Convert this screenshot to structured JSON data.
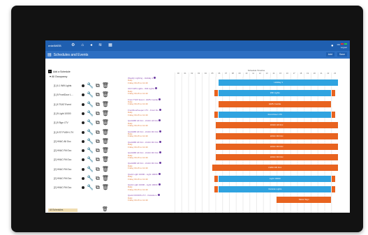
{
  "topbar": {
    "brand": "enteliWEB",
    "nav_icons": [
      "gear-icon",
      "home-icon",
      "back-icon",
      "wifi-icon",
      "calendar-icon"
    ],
    "user_icon": "user-icon",
    "status_text": "OK",
    "logout": "Logout"
  },
  "subheader": {
    "title": "Schedules and Events",
    "actions": [
      "Add",
      "Save"
    ]
  },
  "tree": {
    "root": "Add a Schedule",
    "group": "All Occupancy",
    "rows": [
      {
        "label": "[1] 6.1 Wifi Lights"
      },
      {
        "label": "[1] 8 FrontDoor L..."
      },
      {
        "label": "[1] 8 TSAT Event"
      },
      {
        "label": "[1] 8 Light 10000"
      },
      {
        "label": "[1] 8 Sign LTV"
      },
      {
        "label": "[1] 8 ST PUSH LTV"
      },
      {
        "label": "[2] HVAC All Occ"
      },
      {
        "label": "[2] HVAC Rtl Occ"
      },
      {
        "label": "[2] HVAC Rtl Occ"
      },
      {
        "label": "[2] HVAC Rtl Occ"
      },
      {
        "label": "[2] HVAC Rtl Occ"
      },
      {
        "label": "[2] HVAC Rtl Occ"
      }
    ],
    "schedule_chip": "All Schedules"
  },
  "events": [
    {
      "name": "Weekly Lighting - Holiday 1",
      "sub": "Daily",
      "date": "Friday 09-15 to 10-30"
    },
    {
      "name": "Ulti 6 Wifi Lights - Wifi Lights",
      "sub": "Daily",
      "date": "Friday 09-15 to 10-30"
    },
    {
      "name": "Front TSAT Event - EMS Coolde",
      "sub": "Daily",
      "date": "Friday 09-15 to 10-30"
    },
    {
      "name": "FrontDoorKeeper LTV - Front Do",
      "sub": "Daily",
      "date": "Friday 09-15 to 10-30"
    },
    {
      "name": "QuickMR All Occ - HVAC All Occ",
      "sub": "Daily",
      "date": "Friday 09-15 to 10-30"
    },
    {
      "name": "QuickMR All Occ - HVAC Rtl Occ",
      "sub": "Daily",
      "date": "Friday 09-15 to 10-30"
    },
    {
      "name": "QuickMR All Occ - HVAC Rtl Occ",
      "sub": "Daily",
      "date": "Friday 09-15 to 10-30"
    },
    {
      "name": "QuickMR All Occ - HVAC Rtl Occ",
      "sub": "Daily",
      "date": "Friday 09-15 to 10-30"
    },
    {
      "name": "QuickMR All Occ - HVAC Rtl Occ",
      "sub": "Daily",
      "date": "Friday 09-15 to 10-30"
    },
    {
      "name": "Quick Light 10000 - Light 10000",
      "sub": "Daily",
      "date": "Friday 09-15 to 10-30"
    },
    {
      "name": "Quick Light 10000 - Light 10000",
      "sub": "Daily",
      "date": "Friday 09-15 to 10-30"
    },
    {
      "name": "Quick DOORS LTV - Outside Li",
      "sub": "Daily",
      "date": "Friday 09-15 to 10-30"
    }
  ],
  "gantt": {
    "title": "Schedule Timeline",
    "hours": [
      "00",
      "01",
      "02",
      "03",
      "04",
      "05",
      "06",
      "07",
      "08",
      "09",
      "10",
      "11",
      "12",
      "13",
      "14",
      "15",
      "16",
      "17",
      "18",
      "19",
      "20",
      "21",
      "22",
      "23"
    ],
    "rows": [
      {
        "label": "Holiday 1",
        "state": "on",
        "start": 6.5,
        "end": 24,
        "left_cap": false,
        "right_cap": false
      },
      {
        "label": "Wifi Lights",
        "state": "on",
        "start": 6.5,
        "end": 23,
        "left_cap": true,
        "right_cap": true
      },
      {
        "label": "EMS Coolde",
        "state": "off",
        "start": 6.5,
        "end": 23,
        "left_cap": false,
        "right_cap": false
      },
      {
        "label": "Front Door LTV",
        "state": "on",
        "start": 6.5,
        "end": 23,
        "left_cap": true,
        "right_cap": true
      },
      {
        "label": "HVAC All Occ",
        "state": "off",
        "start": 6,
        "end": 24,
        "left_cap": false,
        "right_cap": false
      },
      {
        "label": "HVAC Rtl Occ",
        "state": "off",
        "start": 6,
        "end": 24,
        "left_cap": false,
        "right_cap": false
      },
      {
        "label": "HVAC Rtl Occ",
        "state": "off",
        "start": 6,
        "end": 24,
        "left_cap": false,
        "right_cap": false
      },
      {
        "label": "HVAC Rtl Occ",
        "state": "off",
        "start": 6,
        "end": 24,
        "left_cap": false,
        "right_cap": false
      },
      {
        "label": "HVAC Rtl Occ",
        "state": "off",
        "start": 5.5,
        "end": 24,
        "left_cap": false,
        "right_cap": false
      },
      {
        "label": "Light 10000",
        "state": "on",
        "start": 6.5,
        "end": 23,
        "left_cap": true,
        "right_cap": true
      },
      {
        "label": "Outside Lights",
        "state": "on",
        "start": 6.5,
        "end": 23,
        "left_cap": true,
        "right_cap": true
      },
      {
        "label": "Motor Sign",
        "state": "off",
        "start": 15,
        "end": 23,
        "left_cap": false,
        "right_cap": false
      }
    ]
  },
  "colors": {
    "on": "#2fa3e0",
    "off": "#e8631f",
    "topbar": "#1f5fb0"
  }
}
